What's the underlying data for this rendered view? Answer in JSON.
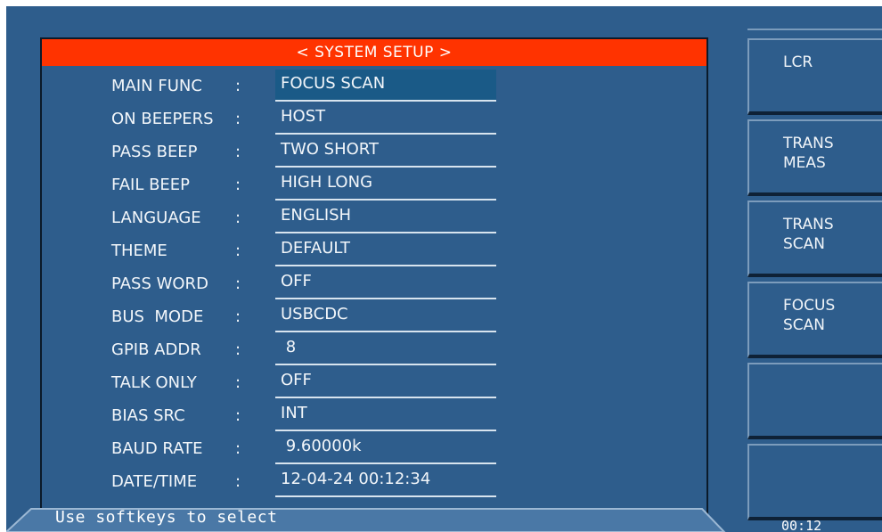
{
  "title": "< SYSTEM SETUP >",
  "settings": [
    {
      "label": "MAIN FUNC",
      "value": "FOCUS SCAN"
    },
    {
      "label": "ON BEEPERS",
      "value": "HOST"
    },
    {
      "label": "PASS BEEP",
      "value": "TWO SHORT"
    },
    {
      "label": "FAIL BEEP",
      "value": "HIGH LONG"
    },
    {
      "label": "LANGUAGE",
      "value": "ENGLISH"
    },
    {
      "label": "THEME",
      "value": "DEFAULT"
    },
    {
      "label": "PASS WORD",
      "value": "OFF"
    },
    {
      "label": "BUS  MODE",
      "value": "USBCDC"
    },
    {
      "label": "GPIB ADDR",
      "value": " 8"
    },
    {
      "label": "TALK ONLY",
      "value": "OFF"
    },
    {
      "label": "BIAS SRC",
      "value": "INT"
    },
    {
      "label": "BAUD RATE",
      "value": " 9.60000k"
    },
    {
      "label": "DATE/TIME",
      "value": "12-04-24 00:12:34"
    }
  ],
  "separator": ":",
  "status_text": "Use softkeys to select",
  "softkeys": [
    {
      "label": "LCR"
    },
    {
      "label": "TRANS\nMEAS"
    },
    {
      "label": "TRANS\nSCAN"
    },
    {
      "label": "FOCUS\nSCAN"
    },
    {
      "label": ""
    },
    {
      "label": ""
    }
  ],
  "time": "00:12",
  "colors": {
    "title_bar": "#ff3300",
    "background": "#2e5d8c",
    "selected": "#1a5a87"
  }
}
